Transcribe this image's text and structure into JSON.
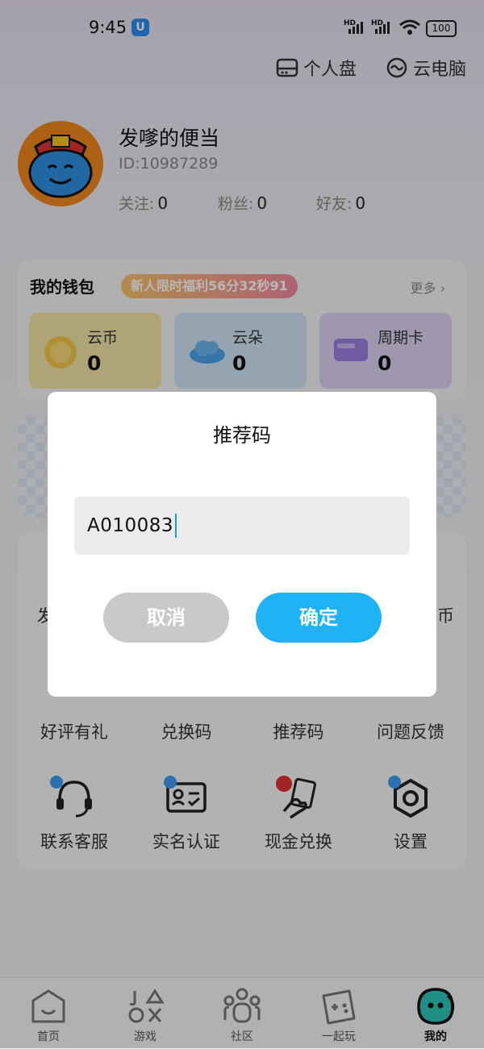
{
  "status_bar": {
    "time": "9:45",
    "hd1": "HD",
    "hd2": "HD",
    "battery": "100"
  },
  "header": {
    "personal_disk": "个人盘",
    "cloud_pc": "云电脑"
  },
  "profile": {
    "name": "发嗲的便当",
    "id": "ID:10987289",
    "stats": [
      {
        "label": "关注:",
        "value": "0"
      },
      {
        "label": "粉丝:",
        "value": "0"
      },
      {
        "label": "好友:",
        "value": "0"
      }
    ]
  },
  "wallet": {
    "title": "我的钱包",
    "promo": "新人限时福利56分32秒91",
    "more": "更多 ›",
    "cards": [
      {
        "label": "云币",
        "value": "0",
        "color": "#f3e3a6"
      },
      {
        "label": "云朵",
        "value": "0",
        "color": "#cfe3f4"
      },
      {
        "label": "周期卡",
        "value": "0",
        "color": "#dcd2f1"
      }
    ]
  },
  "partial_labels": {
    "left": "发",
    "right": "币"
  },
  "functions": [
    {
      "label": "好评有礼",
      "icon": "gift-icon"
    },
    {
      "label": "兑换码",
      "icon": "code-icon"
    },
    {
      "label": "推荐码",
      "icon": "referral-icon"
    },
    {
      "label": "问题反馈",
      "icon": "feedback-icon"
    },
    {
      "label": "联系客服",
      "icon": "headset-icon"
    },
    {
      "label": "实名认证",
      "icon": "id-card-icon"
    },
    {
      "label": "现金兑换",
      "icon": "cash-exchange-icon"
    },
    {
      "label": "设置",
      "icon": "settings-icon"
    }
  ],
  "tabs": [
    {
      "label": "首页",
      "icon": "home-icon"
    },
    {
      "label": "游戏",
      "icon": "games-icon"
    },
    {
      "label": "社区",
      "icon": "community-icon"
    },
    {
      "label": "一起玩",
      "icon": "gamepad-icon"
    },
    {
      "label": "我的",
      "icon": "profile-icon",
      "active": true
    }
  ],
  "dialog": {
    "title": "推荐码",
    "input_value": "A010083",
    "cancel": "取消",
    "confirm": "确定"
  },
  "colors": {
    "accent": "#1fb3f5",
    "cancel": "#c9c9c9",
    "avatar_bg": "#f0871e"
  }
}
